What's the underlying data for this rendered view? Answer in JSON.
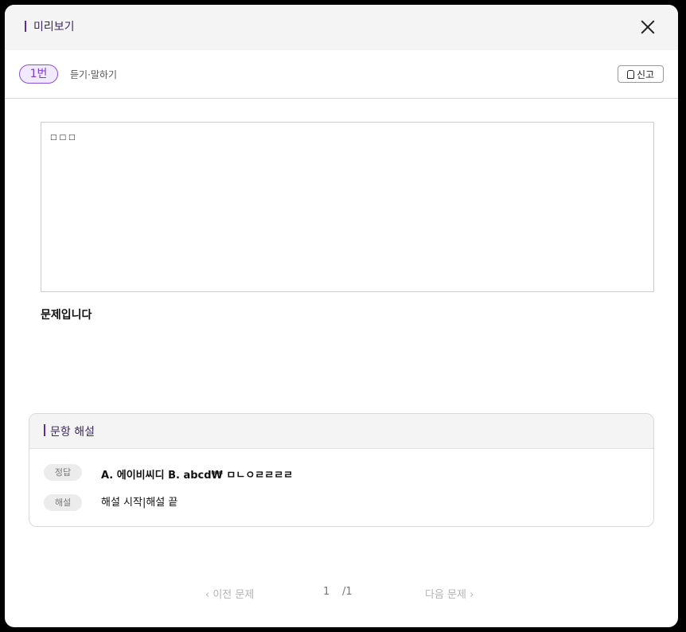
{
  "header": {
    "title": "미리보기",
    "close_icon": "close-icon"
  },
  "question": {
    "number": "1번",
    "type": "듣기·말하기",
    "report_label": "신고",
    "report_icon": "bell-icon",
    "content_glyphs": "□□□",
    "text": "문제입니다"
  },
  "explanation": {
    "title": "문항 해설",
    "answer_tag": "정답",
    "answer": "A. 에이비씨디 B. abcd₩ ㅁㄴㅇㄹㄹㄹㄹ",
    "explain_tag": "해설",
    "explain": "해설 시작|해설 끝"
  },
  "pager": {
    "prev_label": "‹  이전 문제",
    "next_label": "다음 문제  ›",
    "current": "1",
    "total": "/1"
  },
  "colors": {
    "accent": "#7a3fd0",
    "header_bg": "#f4f4f4"
  }
}
